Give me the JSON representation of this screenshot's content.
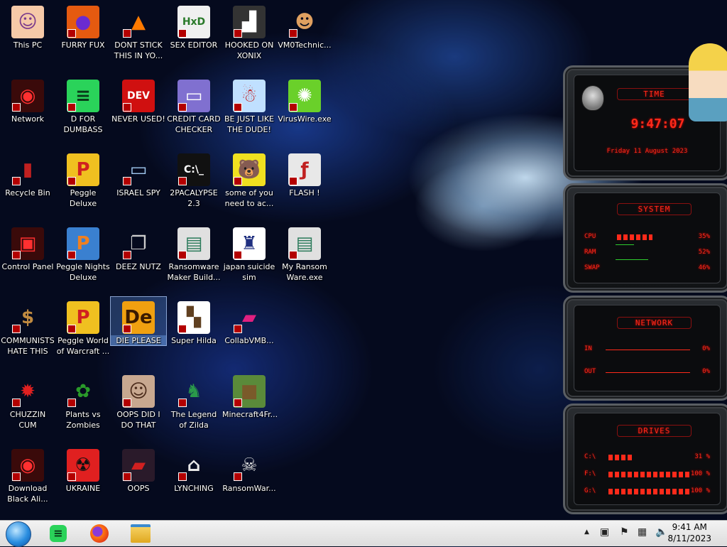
{
  "desktop": {
    "icons": [
      {
        "label": "This PC",
        "symbol": "☺",
        "bg": "#f6c9a8",
        "fg": "#7a3a8c"
      },
      {
        "label": "FURRY FUX",
        "symbol": "●",
        "bg": "#e55a10",
        "fg": "#6a2bd0"
      },
      {
        "label": "DONT STICK THIS IN YO...",
        "symbol": "▲",
        "bg": "transparent",
        "fg": "#ff7a00"
      },
      {
        "label": "SEX EDITOR",
        "symbol": "HxD",
        "bg": "#f0f0f0",
        "fg": "#2a7a2a"
      },
      {
        "label": "HOOKED ON XONIX",
        "symbol": "▟",
        "bg": "#333",
        "fg": "#fff"
      },
      {
        "label": "VM0Technic...",
        "symbol": "☻",
        "bg": "transparent",
        "fg": "#e0a060"
      },
      {
        "label": "Network",
        "symbol": "◉",
        "bg": "#3a0a0a",
        "fg": "#ff3030"
      },
      {
        "label": "D FOR DUMBASS",
        "symbol": "≡",
        "bg": "#2ad35a",
        "fg": "#0a3a1a"
      },
      {
        "label": "NEVER USED!",
        "symbol": "DEV",
        "bg": "#d01010",
        "fg": "#fff"
      },
      {
        "label": "CREDIT CARD CHECKER",
        "symbol": "▭",
        "bg": "#8070d0",
        "fg": "#fff"
      },
      {
        "label": "BE JUST LIKE THE DUDE!",
        "symbol": "☃",
        "bg": "#c0e0ff",
        "fg": "#c02020"
      },
      {
        "label": "VirusWire.exe",
        "symbol": "✺",
        "bg": "#6ad02a",
        "fg": "#fff"
      },
      {
        "label": "Recycle Bin",
        "symbol": "▮",
        "bg": "transparent",
        "fg": "#c02020"
      },
      {
        "label": "Peggle Deluxe",
        "symbol": "P",
        "bg": "#f0c020",
        "fg": "#d02020"
      },
      {
        "label": "ISRAEL SPY",
        "symbol": "▭",
        "bg": "transparent",
        "fg": "#a0c8f0"
      },
      {
        "label": "2PACALYPSE 2.3",
        "symbol": "C:\\_",
        "bg": "#111",
        "fg": "#fff"
      },
      {
        "label": "some of you need to ac...",
        "symbol": "🐻",
        "bg": "#f0e020",
        "fg": "#7a3a10"
      },
      {
        "label": "FLASH !",
        "symbol": "ƒ",
        "bg": "#e8e8e8",
        "fg": "#c02020"
      },
      {
        "label": "Control Panel",
        "symbol": "▣",
        "bg": "#3a0a0a",
        "fg": "#ff3030"
      },
      {
        "label": "Peggle Nights Deluxe",
        "symbol": "P",
        "bg": "#3a80d0",
        "fg": "#f08020"
      },
      {
        "label": "DEEZ NUTZ",
        "symbol": "❐",
        "bg": "transparent",
        "fg": "#ccc"
      },
      {
        "label": "Ransomware Maker Build...",
        "symbol": "▤",
        "bg": "#e0e0e0",
        "fg": "#2a7a5a"
      },
      {
        "label": "japan suicide sim",
        "symbol": "♜",
        "bg": "#fff",
        "fg": "#203080"
      },
      {
        "label": "My Ransom Ware.exe",
        "symbol": "▤",
        "bg": "#e0e0e0",
        "fg": "#2a7a5a"
      },
      {
        "label": "COMMUNISTS HATE THIS G...",
        "symbol": "$",
        "bg": "transparent",
        "fg": "#c08a40"
      },
      {
        "label": "Peggle World of Warcraft ...",
        "symbol": "P",
        "bg": "#f0c020",
        "fg": "#d02020"
      },
      {
        "label": "DIE PLEASE",
        "symbol": "De",
        "bg": "#f0a010",
        "fg": "#3a1a00"
      },
      {
        "label": "Super Hilda",
        "symbol": "▚",
        "bg": "#fff",
        "fg": "#604020"
      },
      {
        "label": "CollabVMB...",
        "symbol": "▰",
        "bg": "transparent",
        "fg": "#e02080"
      },
      {
        "label": "CHUZZIN CUM",
        "symbol": "✹",
        "bg": "transparent",
        "fg": "#e02020"
      },
      {
        "label": "Plants vs Zombies",
        "symbol": "✿",
        "bg": "transparent",
        "fg": "#2a9a2a"
      },
      {
        "label": "OOPS DID I DO THAT",
        "symbol": "☺",
        "bg": "#c8a890",
        "fg": "#4a2a1a"
      },
      {
        "label": "The Legend of Zilda",
        "symbol": "♞",
        "bg": "transparent",
        "fg": "#2a9a4a"
      },
      {
        "label": "Minecraft4Fr...",
        "symbol": "■",
        "bg": "#5a8a3a",
        "fg": "#7a5a2a"
      },
      {
        "label": "Download Black Ali...",
        "symbol": "◉",
        "bg": "#3a0a0a",
        "fg": "#ff3030"
      },
      {
        "label": "UKRAINE",
        "symbol": "☢",
        "bg": "#e02020",
        "fg": "#111"
      },
      {
        "label": "OOPS",
        "symbol": "▰",
        "bg": "#2a1a2a",
        "fg": "#d02020"
      },
      {
        "label": "LYNCHING",
        "symbol": "⌂",
        "bg": "transparent",
        "fg": "#e8e8e8"
      },
      {
        "label": "RansomWar...",
        "symbol": "☠",
        "bg": "transparent",
        "fg": "#ddd"
      }
    ]
  },
  "widget": {
    "time": {
      "title": "TIME",
      "clock": "9:47:07",
      "date": "Friday 11 August 2023"
    },
    "system": {
      "title": "SYSTEM",
      "rows": [
        {
          "label": "CPU",
          "value": "35%",
          "fill": 0.35
        },
        {
          "label": "RAM",
          "value": "52%",
          "fill": 0.0
        },
        {
          "label": "SWAP",
          "value": "46%",
          "fill": 0.0
        }
      ]
    },
    "network": {
      "title": "NETWORK",
      "rows": [
        {
          "label": "IN",
          "value": "0%"
        },
        {
          "label": "OUT",
          "value": "0%"
        }
      ]
    },
    "drives": {
      "title": "DRIVES",
      "rows": [
        {
          "label": "C:\\",
          "value": "31 %",
          "fill": 0.31
        },
        {
          "label": "F:\\",
          "value": "100 %",
          "fill": 1.0
        },
        {
          "label": "G:\\",
          "value": "100 %",
          "fill": 1.0
        }
      ]
    }
  },
  "taskbar": {
    "clock_time": "9:41 AM",
    "clock_date": "8/11/2023",
    "tray_up": "▲",
    "items": [
      {
        "name": "spotify-like-app",
        "symbol": "≡",
        "color": "#2ad35a"
      },
      {
        "name": "firefox",
        "symbol": "●",
        "color": "#e55a10"
      },
      {
        "name": "file-explorer",
        "symbol": "▬",
        "color": "#e8b830"
      }
    ]
  }
}
